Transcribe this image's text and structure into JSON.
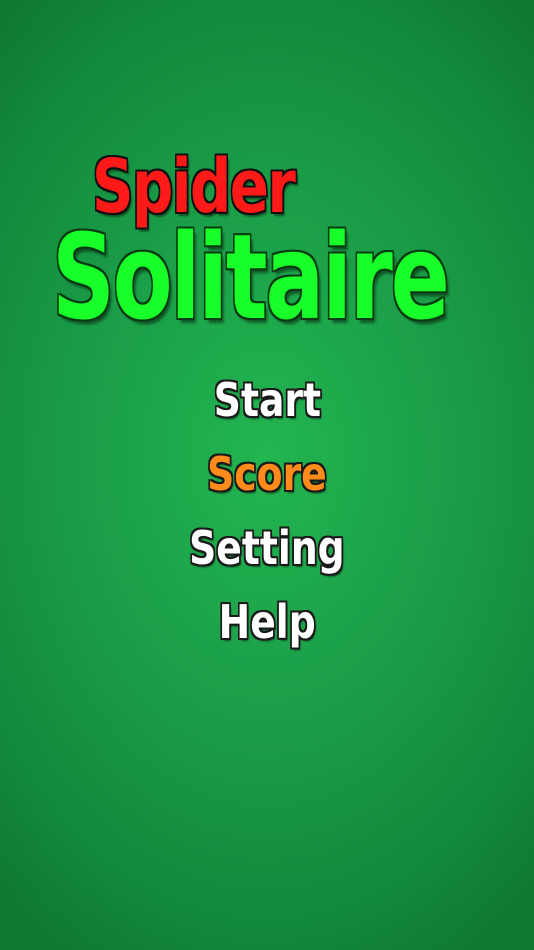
{
  "title": {
    "line1": "Spider",
    "line2": "Solitaire"
  },
  "menu": {
    "items": [
      {
        "label": "Start",
        "color": "#ffffff"
      },
      {
        "label": "Score",
        "color": "#ff8c1a"
      },
      {
        "label": "Setting",
        "color": "#ffffff"
      },
      {
        "label": "Help",
        "color": "#ffffff"
      }
    ]
  },
  "colors": {
    "background": "#1b9e48",
    "title_spider": "#ff1a1a",
    "title_solitaire": "#19ff2a",
    "menu_default": "#ffffff",
    "menu_highlight": "#ff8c1a"
  }
}
